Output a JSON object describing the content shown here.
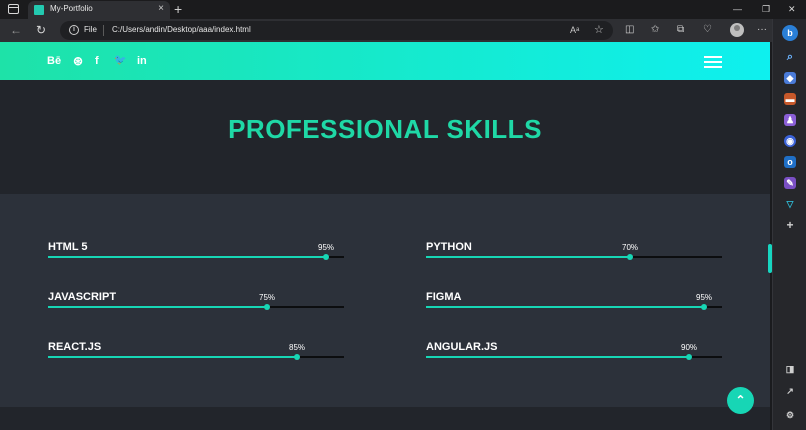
{
  "browser": {
    "tab_title": "My-Portfolio",
    "close_glyph": "×",
    "new_tab_glyph": "+",
    "file_label": "File",
    "url": "C:/Users/andin/Desktop/aaa/index.html",
    "more_glyph": "···",
    "window_controls": {
      "minimize": "—",
      "maximize": "❐",
      "close": "✕"
    }
  },
  "nav": {
    "social_links": [
      {
        "icon": "behance-icon",
        "glyph": "Bē"
      },
      {
        "icon": "dribbble-icon",
        "glyph": "⊛"
      },
      {
        "icon": "facebook-icon",
        "glyph": "f"
      },
      {
        "icon": "twitter-icon",
        "glyph": "🐦"
      },
      {
        "icon": "linkedin-icon",
        "glyph": "in"
      }
    ],
    "menu_icon": "hamburger-icon"
  },
  "section": {
    "title": "PROFESSIONAL SKILLS"
  },
  "skills": [
    {
      "name": "HTML 5",
      "percent_label": "95%",
      "level": 0.94
    },
    {
      "name": "PYTHON",
      "percent_label": "70%",
      "level": 0.69
    },
    {
      "name": "JAVASCRIPT",
      "percent_label": "75%",
      "level": 0.74
    },
    {
      "name": "FIGMA",
      "percent_label": "95%",
      "level": 0.94
    },
    {
      "name": "REACT.JS",
      "percent_label": "85%",
      "level": 0.84
    },
    {
      "name": "ANGULAR.JS",
      "percent_label": "90%",
      "level": 0.89
    }
  ],
  "back_to_top": {
    "icon": "chevron-up-icon",
    "glyph": "⌃"
  },
  "colors": {
    "accent": "#17d6b5",
    "gradient_start": "#1ee2a8",
    "gradient_end": "#0ef0ef",
    "title": "#1fd8a6"
  }
}
